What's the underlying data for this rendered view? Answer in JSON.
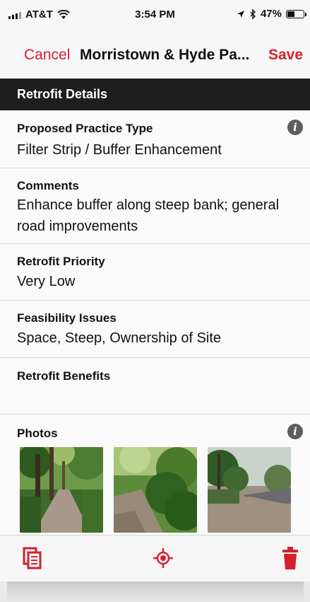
{
  "status_bar": {
    "carrier": "AT&T",
    "time": "3:54 PM",
    "battery_percent": "47%",
    "battery_level": 0.47,
    "icons": [
      "signal-icon",
      "wifi-icon",
      "location-arrow-icon",
      "bluetooth-icon",
      "battery-icon"
    ]
  },
  "nav": {
    "cancel_label": "Cancel",
    "title": "Morristown & Hyde Pa...",
    "save_label": "Save"
  },
  "section_title": "Retrofit Details",
  "fields": {
    "practice_type": {
      "label": "Proposed Practice Type",
      "value": "Filter Strip / Buffer Enhancement"
    },
    "comments": {
      "label": "Comments",
      "value": "Enhance buffer along steep bank; general road improvements"
    },
    "priority": {
      "label": "Retrofit Priority",
      "value": "Very Low"
    },
    "feasibility": {
      "label": "Feasibility Issues",
      "value": "Space, Steep, Ownership of Site"
    },
    "benefits": {
      "label": "Retrofit Benefits",
      "value": ""
    }
  },
  "photos": {
    "label": "Photos",
    "items": [
      "forest-path-photo",
      "roadside-vegetation-photo",
      "road-edge-photo"
    ]
  },
  "info_icon_glyph": "i",
  "toolbar": {
    "icons": [
      "copy-document-icon",
      "locate-target-icon",
      "trash-icon"
    ]
  },
  "colors": {
    "accent": "#d6202d",
    "header_bg": "#1e1e1e",
    "info_icon": "#5d5d5d"
  }
}
